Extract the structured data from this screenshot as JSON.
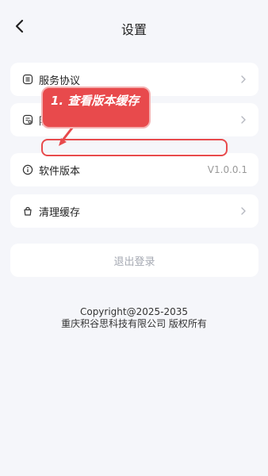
{
  "header": {
    "title": "设置",
    "back_icon": "chevron-left-icon"
  },
  "settings": {
    "items": [
      {
        "label": "服务协议",
        "icon": "document-list-icon",
        "value": "",
        "chevron": true
      },
      {
        "label": "隐私政策",
        "icon": "privacy-doc-icon",
        "value": "",
        "chevron": true
      },
      {
        "label": "软件版本",
        "icon": "info-circle-icon",
        "value": "V1.0.0.1",
        "chevron": false
      },
      {
        "label": "清理缓存",
        "icon": "broom-icon",
        "value": "",
        "chevron": true
      }
    ]
  },
  "logout": {
    "label": "退出登录"
  },
  "footer": {
    "copyright": "Copyright@2025-2035",
    "company": "重庆积谷思科技有限公司 版权所有"
  },
  "annotation": {
    "text": "1. 查看版本缓存",
    "color": "#e84a4c"
  }
}
